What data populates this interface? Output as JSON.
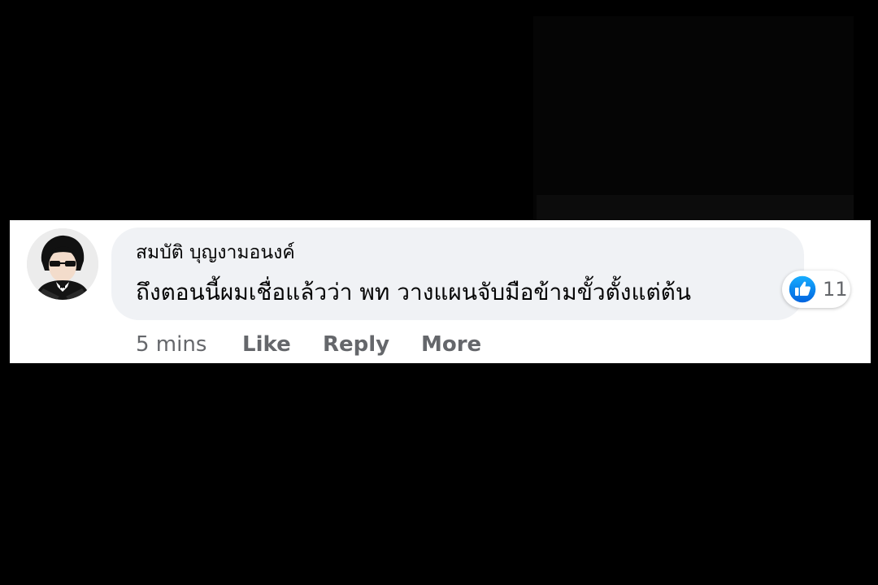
{
  "comment": {
    "author": "สมบัติ บุญงามอนงค์",
    "text": "ถึงตอนนี้ผมเชื่อแล้วว่า พท วางแผนจับมือข้ามขั้วตั้งแต่ต้น",
    "timestamp": "5 mins",
    "actions": {
      "like": "Like",
      "reply": "Reply",
      "more": "More"
    },
    "reactions": {
      "icon": "thumbs-up-icon",
      "count": "11",
      "color": "#1877f2"
    }
  },
  "colors": {
    "background": "#000000",
    "bubble": "#f0f2f5",
    "secondary_text": "#65676b",
    "like_blue": "#1877f2"
  }
}
